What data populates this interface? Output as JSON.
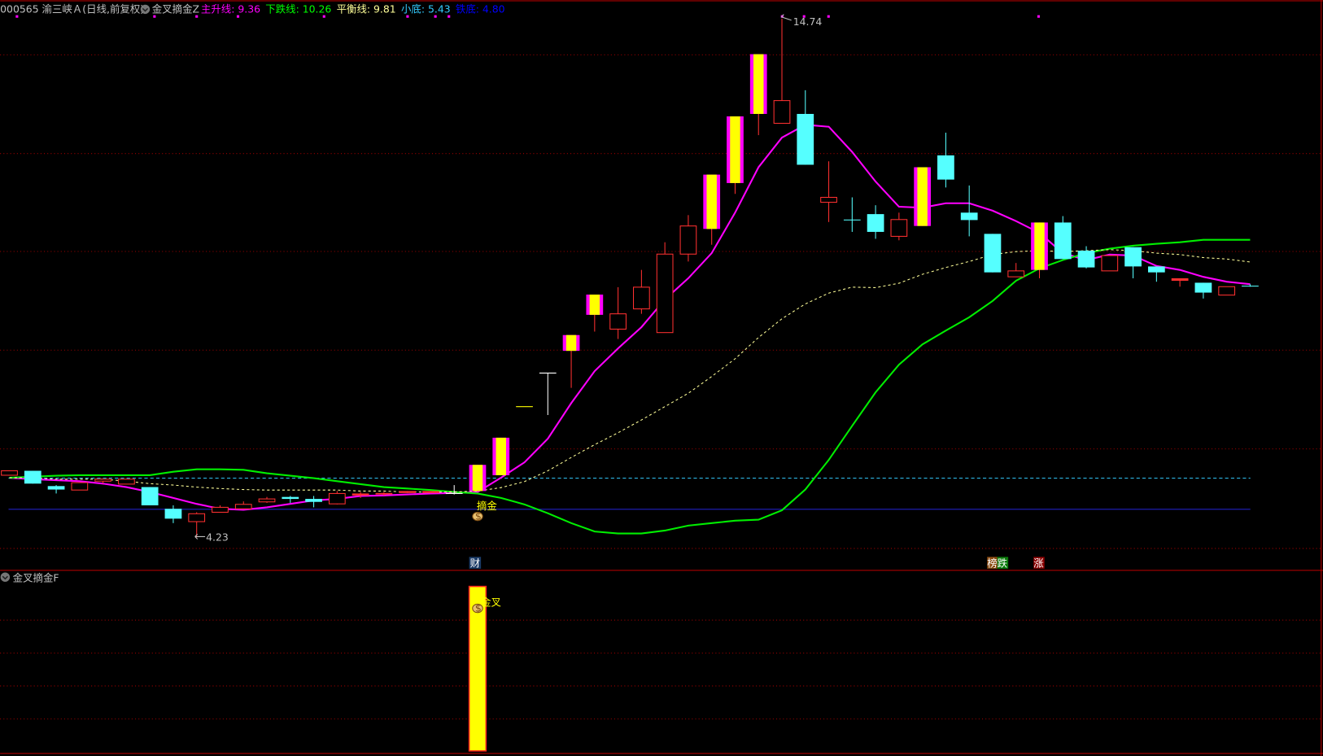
{
  "header": {
    "stock": "000565 渝三峡Ａ(日线,前复权)",
    "indicator": "金叉摘金Z",
    "items": [
      {
        "label": "主升线:",
        "value": "9.36",
        "color": "#ff00ff"
      },
      {
        "label": "下跌线:",
        "value": "10.26",
        "color": "#00ff00"
      },
      {
        "label": "平衡线:",
        "value": "9.81",
        "color": "#ffff99"
      },
      {
        "label": "小底:",
        "value": "5.43",
        "color": "#33ccff"
      },
      {
        "label": "铁底:",
        "value": "4.80",
        "color": "#0000ff"
      }
    ]
  },
  "sub_panel": {
    "title": "金叉摘金F",
    "signal_label": "金叉"
  },
  "annotations": {
    "high_label": "14.74",
    "low_label": "4.23",
    "buy_label": "摘金",
    "cai": "财",
    "bang": "榜",
    "die": "跌",
    "zhang": "涨"
  },
  "chart_data": {
    "type": "candlestick",
    "title": "000565 渝三峡Ａ(日线,前复权)",
    "ylim": [
      3.8,
      15.1
    ],
    "reference_lines": {
      "小底": 5.43,
      "铁底": 4.8
    },
    "candles": [
      {
        "o": 5.49,
        "h": 5.58,
        "l": 5.49,
        "c": 5.58,
        "t": "up"
      },
      {
        "o": 5.58,
        "h": 5.58,
        "l": 5.32,
        "c": 5.32,
        "t": "down"
      },
      {
        "o": 5.27,
        "h": 5.29,
        "l": 5.12,
        "c": 5.2,
        "t": "down"
      },
      {
        "o": 5.19,
        "h": 5.34,
        "l": 5.19,
        "c": 5.34,
        "t": "up"
      },
      {
        "o": 5.37,
        "h": 5.41,
        "l": 5.32,
        "c": 5.41,
        "t": "up"
      },
      {
        "o": 5.31,
        "h": 5.41,
        "l": 5.31,
        "c": 5.41,
        "t": "up"
      },
      {
        "o": 5.25,
        "h": 5.25,
        "l": 4.88,
        "c": 4.88,
        "t": "down"
      },
      {
        "o": 4.81,
        "h": 4.88,
        "l": 4.52,
        "c": 4.61,
        "t": "down"
      },
      {
        "o": 4.55,
        "h": 4.74,
        "l": 4.23,
        "c": 4.71,
        "t": "up"
      },
      {
        "o": 4.74,
        "h": 4.88,
        "l": 4.74,
        "c": 4.84,
        "t": "up"
      },
      {
        "o": 4.81,
        "h": 4.96,
        "l": 4.81,
        "c": 4.9,
        "t": "up"
      },
      {
        "o": 4.95,
        "h": 5.05,
        "l": 4.93,
        "c": 5.01,
        "t": "up"
      },
      {
        "o": 5.05,
        "h": 5.07,
        "l": 4.93,
        "c": 5.01,
        "t": "down"
      },
      {
        "o": 5.01,
        "h": 5.07,
        "l": 4.84,
        "c": 4.95,
        "t": "down"
      },
      {
        "o": 4.91,
        "h": 5.17,
        "l": 4.9,
        "c": 5.12,
        "t": "up"
      },
      {
        "o": 5.08,
        "h": 5.15,
        "l": 5.03,
        "c": 5.12,
        "t": "upfill"
      },
      {
        "o": 5.1,
        "h": 5.15,
        "l": 5.08,
        "c": 5.13,
        "t": "upfill"
      },
      {
        "o": 5.13,
        "h": 5.17,
        "l": 5.13,
        "c": 5.17,
        "t": "upfill"
      },
      {
        "o": 5.13,
        "h": 5.17,
        "l": 5.13,
        "c": 5.17,
        "t": "upfill"
      },
      {
        "o": 5.12,
        "h": 5.29,
        "l": 5.1,
        "c": 5.12,
        "t": "doji"
      },
      {
        "o": 5.17,
        "h": 5.7,
        "l": 5.17,
        "c": 5.7,
        "t": "strong"
      },
      {
        "o": 5.49,
        "h": 6.25,
        "l": 5.49,
        "c": 6.25,
        "t": "strong"
      },
      {
        "o": 6.88,
        "h": 6.88,
        "l": 6.88,
        "c": 6.88,
        "t": "flat"
      },
      {
        "o": 7.56,
        "h": 7.56,
        "l": 6.71,
        "c": 7.56,
        "t": "doji"
      },
      {
        "o": 8.01,
        "h": 8.33,
        "l": 7.26,
        "c": 8.33,
        "t": "strong"
      },
      {
        "o": 8.74,
        "h": 9.15,
        "l": 8.4,
        "c": 9.15,
        "t": "strong"
      },
      {
        "o": 8.45,
        "h": 9.3,
        "l": 8.25,
        "c": 8.76,
        "t": "up"
      },
      {
        "o": 8.86,
        "h": 9.65,
        "l": 8.76,
        "c": 9.3,
        "t": "up"
      },
      {
        "o": 8.38,
        "h": 10.21,
        "l": 8.38,
        "c": 9.97,
        "t": "up"
      },
      {
        "o": 9.97,
        "h": 10.76,
        "l": 9.82,
        "c": 10.54,
        "t": "up"
      },
      {
        "o": 10.48,
        "h": 11.58,
        "l": 10.16,
        "c": 11.58,
        "t": "strong"
      },
      {
        "o": 11.41,
        "h": 12.76,
        "l": 11.19,
        "c": 12.76,
        "t": "strong"
      },
      {
        "o": 12.81,
        "h": 14.02,
        "l": 12.38,
        "c": 14.02,
        "t": "strong"
      },
      {
        "o": 12.62,
        "h": 14.74,
        "l": 12.62,
        "c": 13.08,
        "t": "up"
      },
      {
        "o": 12.81,
        "h": 13.29,
        "l": 11.78,
        "c": 11.78,
        "t": "down"
      },
      {
        "o": 11.02,
        "h": 11.85,
        "l": 10.62,
        "c": 11.12,
        "t": "up"
      },
      {
        "o": 10.67,
        "h": 11.12,
        "l": 10.42,
        "c": 10.67,
        "t": "down"
      },
      {
        "o": 10.78,
        "h": 10.96,
        "l": 10.28,
        "c": 10.42,
        "t": "down"
      },
      {
        "o": 10.33,
        "h": 10.81,
        "l": 10.25,
        "c": 10.67,
        "t": "up"
      },
      {
        "o": 10.54,
        "h": 11.73,
        "l": 10.54,
        "c": 11.73,
        "t": "strong"
      },
      {
        "o": 11.97,
        "h": 12.43,
        "l": 11.32,
        "c": 11.48,
        "t": "down"
      },
      {
        "o": 10.81,
        "h": 11.36,
        "l": 10.33,
        "c": 10.66,
        "t": "down"
      },
      {
        "o": 10.38,
        "h": 10.38,
        "l": 9.6,
        "c": 9.6,
        "t": "down"
      },
      {
        "o": 9.51,
        "h": 9.79,
        "l": 9.51,
        "c": 9.63,
        "t": "up"
      },
      {
        "o": 9.65,
        "h": 10.61,
        "l": 9.48,
        "c": 10.61,
        "t": "strong"
      },
      {
        "o": 10.61,
        "h": 10.74,
        "l": 9.87,
        "c": 9.87,
        "t": "down"
      },
      {
        "o": 10.04,
        "h": 10.13,
        "l": 9.68,
        "c": 9.7,
        "t": "down"
      },
      {
        "o": 9.63,
        "h": 9.94,
        "l": 9.63,
        "c": 9.94,
        "t": "up"
      },
      {
        "o": 10.11,
        "h": 10.11,
        "l": 9.48,
        "c": 9.72,
        "t": "down"
      },
      {
        "o": 9.72,
        "h": 9.72,
        "l": 9.41,
        "c": 9.6,
        "t": "down"
      },
      {
        "o": 9.43,
        "h": 9.48,
        "l": 9.31,
        "c": 9.48,
        "t": "upfill"
      },
      {
        "o": 9.39,
        "h": 9.39,
        "l": 9.07,
        "c": 9.19,
        "t": "down"
      },
      {
        "o": 9.14,
        "h": 9.31,
        "l": 9.14,
        "c": 9.31,
        "t": "up"
      },
      {
        "o": 9.33,
        "h": 9.36,
        "l": 9.31,
        "c": 9.33,
        "t": "down"
      }
    ],
    "series": [
      {
        "name": "主升线",
        "color": "#ff00ff",
        "values": [
          5.44,
          5.41,
          5.39,
          5.37,
          5.32,
          5.25,
          5.15,
          5.03,
          4.91,
          4.81,
          4.79,
          4.84,
          4.91,
          4.98,
          5.01,
          5.07,
          5.08,
          5.1,
          5.12,
          5.13,
          5.15,
          5.44,
          5.75,
          6.23,
          6.95,
          7.6,
          8.06,
          8.49,
          9.05,
          9.48,
          9.99,
          10.81,
          11.73,
          12.33,
          12.59,
          12.55,
          12.04,
          11.44,
          10.93,
          10.91,
          11.0,
          11.0,
          10.85,
          10.64,
          10.4,
          9.99,
          9.85,
          9.96,
          9.94,
          9.73,
          9.65,
          9.51,
          9.41,
          9.36
        ]
      },
      {
        "name": "下跌线",
        "color": "#00ee00",
        "values": [
          5.44,
          5.46,
          5.48,
          5.49,
          5.49,
          5.49,
          5.49,
          5.56,
          5.61,
          5.61,
          5.6,
          5.53,
          5.48,
          5.43,
          5.37,
          5.31,
          5.25,
          5.22,
          5.19,
          5.15,
          5.12,
          5.03,
          4.9,
          4.72,
          4.52,
          4.35,
          4.31,
          4.31,
          4.37,
          4.47,
          4.52,
          4.57,
          4.59,
          4.78,
          5.2,
          5.8,
          6.49,
          7.17,
          7.73,
          8.14,
          8.42,
          8.69,
          9.02,
          9.43,
          9.68,
          9.85,
          9.99,
          10.08,
          10.14,
          10.18,
          10.21,
          10.26,
          10.26,
          10.26
        ]
      },
      {
        "name": "平衡线",
        "color": "#ffff99",
        "dashed": true,
        "values": [
          5.44,
          5.44,
          5.41,
          5.41,
          5.41,
          5.37,
          5.32,
          5.29,
          5.25,
          5.22,
          5.2,
          5.19,
          5.19,
          5.19,
          5.19,
          5.17,
          5.17,
          5.15,
          5.15,
          5.15,
          5.17,
          5.24,
          5.36,
          5.58,
          5.85,
          6.11,
          6.35,
          6.61,
          6.88,
          7.15,
          7.49,
          7.85,
          8.28,
          8.66,
          8.96,
          9.18,
          9.3,
          9.29,
          9.38,
          9.56,
          9.7,
          9.82,
          9.96,
          10.02,
          10.04,
          10.02,
          10.04,
          10.06,
          10.04,
          9.99,
          9.96,
          9.9,
          9.87,
          9.81
        ]
      }
    ],
    "signals": {
      "buy_index": 20,
      "sub_bar_index": 20,
      "cai_index": 20,
      "bang_index": 42,
      "zhang_index": 44
    }
  }
}
